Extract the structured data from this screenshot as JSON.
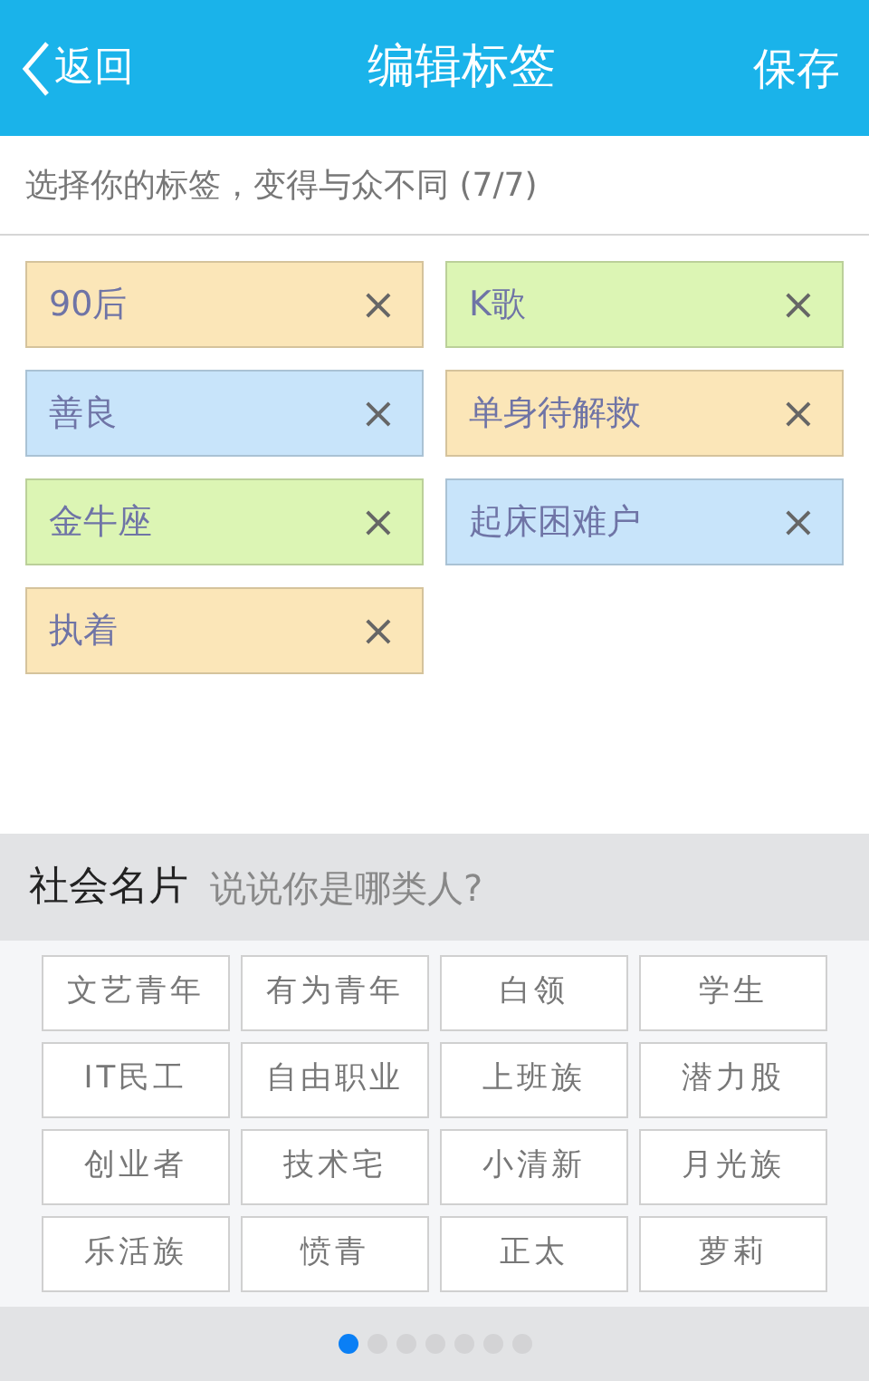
{
  "header": {
    "back": "返回",
    "title": "编辑标签",
    "save": "保存"
  },
  "hint": "选择你的标签，变得与众不同 (7/7)",
  "tags": [
    {
      "label": "90后",
      "color": "#fbe6b8"
    },
    {
      "label": "K歌",
      "color": "#dcf5b4"
    },
    {
      "label": "善良",
      "color": "#c8e4fa"
    },
    {
      "label": "单身待解救",
      "color": "#fbe6b8"
    },
    {
      "label": "金牛座",
      "color": "#dcf5b4"
    },
    {
      "label": "起床困难户",
      "color": "#c8e4fa"
    },
    {
      "label": "执着",
      "color": "#fbe6b8"
    }
  ],
  "remove_symbol": "×",
  "section": {
    "title": "社会名片",
    "subtitle": "说说你是哪类人?"
  },
  "options": [
    "文艺青年",
    "有为青年",
    "白领",
    "学生",
    "IT民工",
    "自由职业",
    "上班族",
    "潜力股",
    "创业者",
    "技术宅",
    "小清新",
    "月光族",
    "乐活族",
    "愤青",
    "正太",
    "萝莉"
  ],
  "pages": [
    {
      "selected": true
    },
    {
      "selected": false
    },
    {
      "selected": false
    },
    {
      "selected": false
    },
    {
      "selected": false
    },
    {
      "selected": false
    },
    {
      "selected": false
    }
  ]
}
